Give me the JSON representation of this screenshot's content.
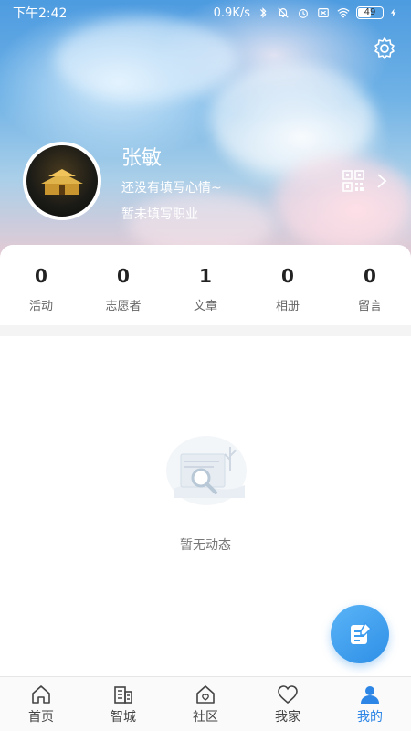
{
  "status_bar": {
    "time": "下午2:42",
    "speed": "0.9K/s",
    "battery": "49"
  },
  "profile": {
    "name": "张敏",
    "mood": "还没有填写心情~",
    "job": "暂未填写职业"
  },
  "stats": [
    {
      "value": "0",
      "label": "活动"
    },
    {
      "value": "0",
      "label": "志愿者"
    },
    {
      "value": "1",
      "label": "文章"
    },
    {
      "value": "0",
      "label": "相册"
    },
    {
      "value": "0",
      "label": "留言"
    }
  ],
  "empty_text": "暂无动态",
  "tabs": [
    {
      "label": "首页",
      "icon": "home-icon",
      "active": false
    },
    {
      "label": "智城",
      "icon": "building-icon",
      "active": false
    },
    {
      "label": "社区",
      "icon": "community-house-icon",
      "active": false
    },
    {
      "label": "我家",
      "icon": "heart-icon",
      "active": false
    },
    {
      "label": "我的",
      "icon": "user-icon",
      "active": true
    }
  ],
  "colors": {
    "accent": "#2d86e6",
    "fab": "#3a9bef"
  }
}
